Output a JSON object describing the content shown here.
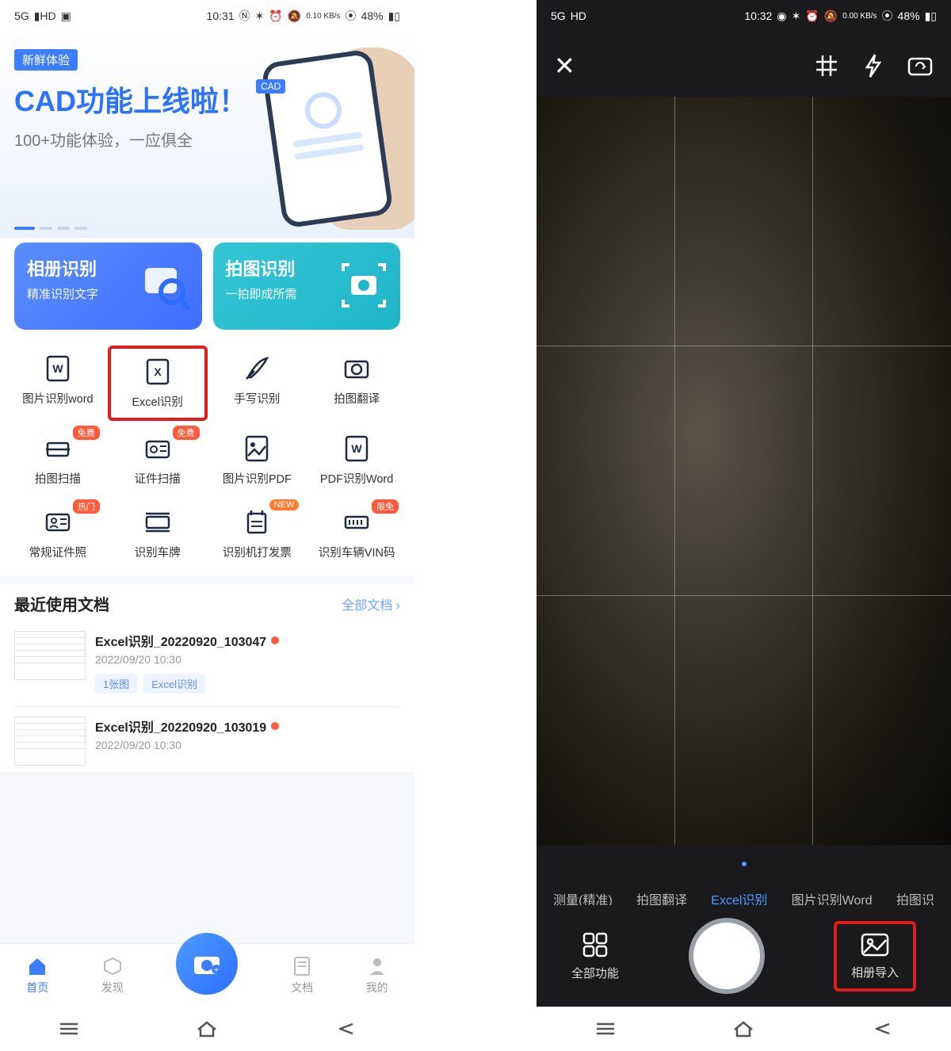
{
  "left": {
    "status": {
      "time": "10:31",
      "net": "5G",
      "hd": "HD",
      "speed": "0.10 KB/s",
      "battery": "48%"
    },
    "hero": {
      "fresh": "新鲜体验",
      "title": "CAD功能上线啦！",
      "sub": "100+功能体验，一应俱全",
      "cad": "CAD"
    },
    "cards": {
      "album": {
        "title": "相册识别",
        "sub": "精准识别文字"
      },
      "shoot": {
        "title": "拍图识别",
        "sub": "一拍即成所需"
      }
    },
    "grid": [
      {
        "label": "图片识别word",
        "tag": ""
      },
      {
        "label": "Excel识别",
        "tag": ""
      },
      {
        "label": "手写识别",
        "tag": ""
      },
      {
        "label": "拍图翻译",
        "tag": ""
      },
      {
        "label": "拍图扫描",
        "tag": "免费"
      },
      {
        "label": "证件扫描",
        "tag": "免费"
      },
      {
        "label": "图片识别PDF",
        "tag": ""
      },
      {
        "label": "PDF识别Word",
        "tag": ""
      },
      {
        "label": "常规证件照",
        "tag": "热门"
      },
      {
        "label": "识别车牌",
        "tag": ""
      },
      {
        "label": "识别机打发票",
        "tag": "NEW"
      },
      {
        "label": "识别车辆VIN码",
        "tag": "限免"
      }
    ],
    "recent": {
      "title": "最近使用文档",
      "all": "全部文档 ›",
      "docs": [
        {
          "name": "Excel识别_20220920_103047",
          "time": "2022/09/20 10:30",
          "pill1": "1张图",
          "pill2": "Excel识别"
        },
        {
          "name": "Excel识别_20220920_103019",
          "time": "2022/09/20 10:30"
        }
      ]
    },
    "nav": {
      "home": "首页",
      "find": "发现",
      "doc": "文档",
      "me": "我的"
    }
  },
  "right": {
    "status": {
      "time": "10:32",
      "net": "5G",
      "hd": "HD",
      "speed": "0.00 KB/s",
      "battery": "48%"
    },
    "modes": [
      "测量(精准)",
      "拍图翻译",
      "Excel识别",
      "图片识别Word",
      "拍图识"
    ],
    "bottom": {
      "all": "全部功能",
      "import": "相册导入"
    }
  }
}
